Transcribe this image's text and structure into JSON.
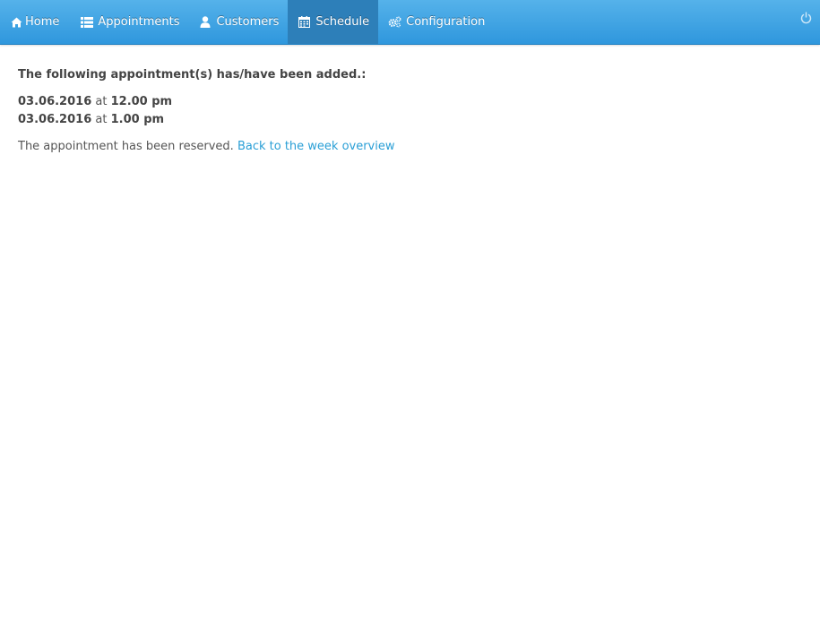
{
  "nav": {
    "items": [
      {
        "label": "Home",
        "icon": "home-icon"
      },
      {
        "label": "Appointments",
        "icon": "list-icon"
      },
      {
        "label": "Customers",
        "icon": "user-icon"
      },
      {
        "label": "Schedule",
        "icon": "calendar-icon"
      },
      {
        "label": "Configuration",
        "icon": "cogs-icon"
      }
    ],
    "active": "Schedule",
    "power_icon": "power-icon"
  },
  "content": {
    "heading": "The following appointment(s) has/have been added.:",
    "appointments": [
      {
        "date": "03.06.2016",
        "at": "at",
        "time": "12.00 pm"
      },
      {
        "date": "03.06.2016",
        "at": "at",
        "time": "1.00 pm"
      }
    ],
    "reserved_text": "The appointment has been reserved.",
    "back_link": "Back to the week overview"
  },
  "colors": {
    "nav_top": "#55b2ea",
    "nav_bottom": "#2f97dd",
    "nav_active": "#2d7fb9",
    "link": "#2a9fd6"
  }
}
